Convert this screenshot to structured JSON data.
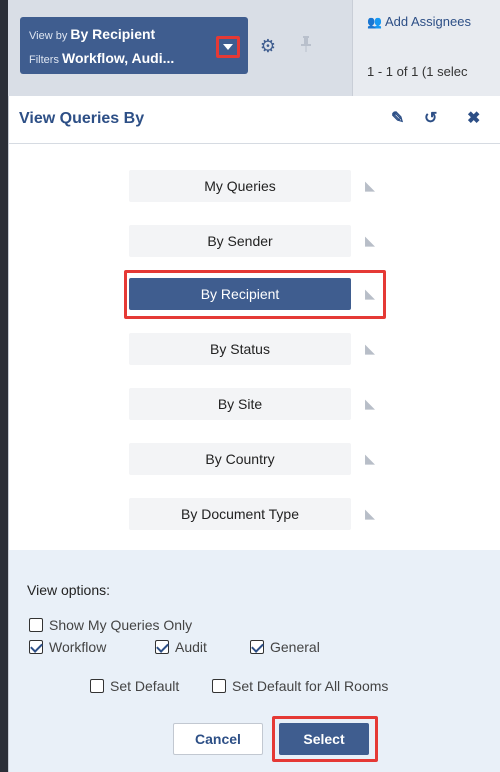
{
  "toolbar": {
    "view_by_prefix": "View by",
    "view_by_value": "By Recipient",
    "filters_prefix": "Filters",
    "filters_value": "Workflow, Audi...",
    "add_assignees": "Add Assignees",
    "page_count": "1 - 1 of 1 (1 selec",
    "icons": {
      "caret": "chevron-down-icon",
      "settings": "gear-icon",
      "pin": "pin-icon",
      "add_user": "add-user-icon"
    }
  },
  "panel": {
    "title": "View Queries By",
    "icons": {
      "edit": "pencil-icon",
      "reset": "undo-icon",
      "close": "close-icon"
    },
    "options": [
      {
        "label": "My Queries",
        "selected": false
      },
      {
        "label": "By Sender",
        "selected": false
      },
      {
        "label": "By Recipient",
        "selected": true
      },
      {
        "label": "By Status",
        "selected": false
      },
      {
        "label": "By Site",
        "selected": false
      },
      {
        "label": "By Country",
        "selected": false
      },
      {
        "label": "By Document Type",
        "selected": false
      }
    ]
  },
  "view_options": {
    "label": "View options:",
    "show_my_queries_only": {
      "label": "Show My Queries Only",
      "checked": false
    },
    "workflow": {
      "label": "Workflow",
      "checked": true
    },
    "audit": {
      "label": "Audit",
      "checked": true
    },
    "general": {
      "label": "General",
      "checked": true
    },
    "set_default": {
      "label": "Set Default",
      "checked": false
    },
    "set_default_all_rooms": {
      "label": "Set Default for All Rooms",
      "checked": false
    }
  },
  "buttons": {
    "cancel": "Cancel",
    "select": "Select"
  },
  "colors": {
    "accent": "#3f5d8f",
    "highlight": "#e53935",
    "footer_bg": "#e9f0f8"
  }
}
